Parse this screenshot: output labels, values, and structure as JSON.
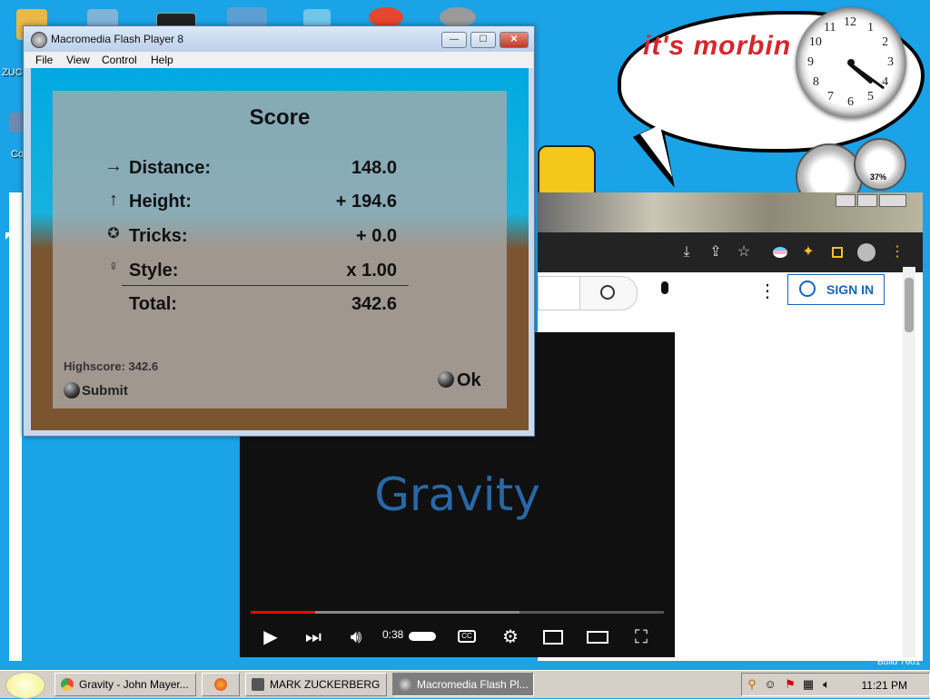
{
  "bubble": {
    "text": "it's morbin"
  },
  "clock_gadget": {
    "numbers": [
      "12",
      "1",
      "2",
      "3",
      "4",
      "5",
      "6",
      "7",
      "8",
      "9",
      "10",
      "11"
    ],
    "time": {
      "hour": 4,
      "minute": 21
    }
  },
  "gauge": {
    "cpu_label": "37%"
  },
  "desktop_icons": [
    {
      "label": "ZUC"
    },
    {
      "label": "Co"
    }
  ],
  "flash_window": {
    "title": "Macromedia Flash Player 8",
    "buttons": {
      "minimize": "—",
      "maximize": "☐",
      "close": "✕"
    },
    "menu": [
      "File",
      "View",
      "Control",
      "Help"
    ],
    "score_panel": {
      "title": "Score",
      "rows": [
        {
          "icon": "→",
          "label": "Distance:",
          "value": "148.0"
        },
        {
          "icon": "↑",
          "label": "Height:",
          "value": "+ 194.6"
        },
        {
          "icon": "✪",
          "label": "Tricks:",
          "value": "+ 0.0"
        },
        {
          "icon": "♀",
          "label": "Style:",
          "value": "x 1.00"
        },
        {
          "icon": "",
          "label": "Total:",
          "value": "342.6"
        }
      ],
      "highscore": "Highscore: 342.6",
      "submit_label": "Submit",
      "ok_label": "Ok"
    }
  },
  "chrome": {
    "toolbar_icons": [
      "download-icon",
      "share-icon",
      "star-icon",
      "flag-icon",
      "extensions-icon",
      "sidebar-icon",
      "profile-icon",
      "kebab-icon"
    ],
    "youtube": {
      "sign_in_label": "SIGN IN"
    },
    "video": {
      "title_text": "Gravity",
      "time": "0:38",
      "progress": 0.155,
      "buffered": 0.65
    }
  },
  "taskbar": {
    "tasks": [
      {
        "label": "Gravity - John Mayer...",
        "icon_color": "#e84b3a"
      },
      {
        "label": "",
        "icon_color": "#ff7a1a"
      },
      {
        "label": "MARK ZUCKERBERG",
        "icon_color": "#333333"
      },
      {
        "label": "Macromedia Flash Pl...",
        "icon_color": "#888888"
      }
    ],
    "time": "11:21 PM",
    "build_text": "Build 7601"
  }
}
